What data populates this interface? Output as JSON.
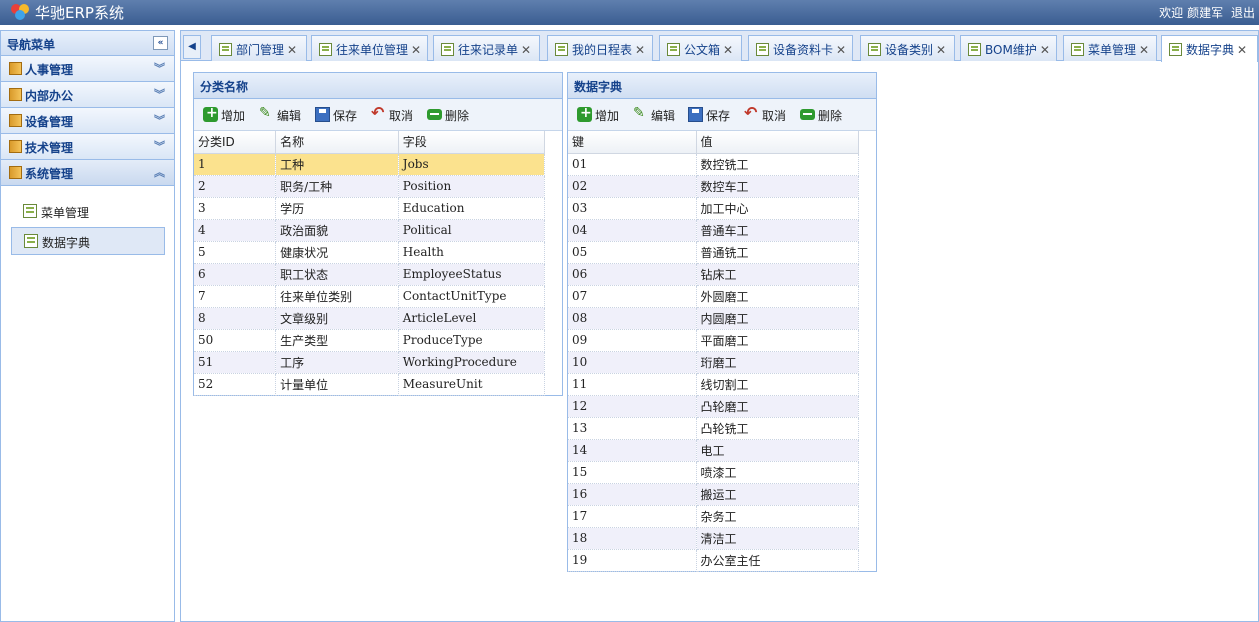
{
  "app": {
    "title": "华驰ERP系统",
    "welcome": "欢迎",
    "user": "颜建军",
    "logout": "退出"
  },
  "nav": {
    "header": "导航菜单",
    "groups": [
      {
        "label": "人事管理"
      },
      {
        "label": "内部办公"
      },
      {
        "label": "设备管理"
      },
      {
        "label": "技术管理"
      },
      {
        "label": "系统管理"
      }
    ],
    "sub_items": [
      {
        "label": "菜单管理"
      },
      {
        "label": "数据字典"
      }
    ]
  },
  "tabs": [
    {
      "label": "部门管理"
    },
    {
      "label": "往来单位管理"
    },
    {
      "label": "往来记录单"
    },
    {
      "label": "我的日程表"
    },
    {
      "label": "公文箱"
    },
    {
      "label": "设备资料卡"
    },
    {
      "label": "设备类别"
    },
    {
      "label": "BOM维护"
    },
    {
      "label": "菜单管理"
    },
    {
      "label": "数据字典"
    }
  ],
  "toolbar": {
    "add": "增加",
    "edit": "编辑",
    "save": "保存",
    "cancel": "取消",
    "delete": "删除"
  },
  "category_panel": {
    "title": "分类名称",
    "columns": [
      "分类ID",
      "名称",
      "字段"
    ],
    "rows": [
      [
        "1",
        "工种",
        "Jobs"
      ],
      [
        "2",
        "职务/工种",
        "Position"
      ],
      [
        "3",
        "学历",
        "Education"
      ],
      [
        "4",
        "政治面貌",
        "Political"
      ],
      [
        "5",
        "健康状况",
        "Health"
      ],
      [
        "6",
        "职工状态",
        "EmployeeStatus"
      ],
      [
        "7",
        "往来单位类别",
        "ContactUnitType"
      ],
      [
        "8",
        "文章级别",
        "ArticleLevel"
      ],
      [
        "50",
        "生产类型",
        "ProduceType"
      ],
      [
        "51",
        "工序",
        "WorkingProcedure"
      ],
      [
        "52",
        "计量单位",
        "MeasureUnit"
      ]
    ]
  },
  "dict_panel": {
    "title": "数据字典",
    "columns": [
      "键",
      "值"
    ],
    "rows": [
      [
        "01",
        "数控铣工"
      ],
      [
        "02",
        "数控车工"
      ],
      [
        "03",
        "加工中心"
      ],
      [
        "04",
        "普通车工"
      ],
      [
        "05",
        "普通铣工"
      ],
      [
        "06",
        "钻床工"
      ],
      [
        "07",
        "外圆磨工"
      ],
      [
        "08",
        "内圆磨工"
      ],
      [
        "09",
        "平面磨工"
      ],
      [
        "10",
        "珩磨工"
      ],
      [
        "11",
        "线切割工"
      ],
      [
        "12",
        "凸轮磨工"
      ],
      [
        "13",
        "凸轮铣工"
      ],
      [
        "14",
        "电工"
      ],
      [
        "15",
        "喷漆工"
      ],
      [
        "16",
        "搬运工"
      ],
      [
        "17",
        "杂务工"
      ],
      [
        "18",
        "清洁工"
      ],
      [
        "19",
        "办公室主任"
      ]
    ]
  }
}
